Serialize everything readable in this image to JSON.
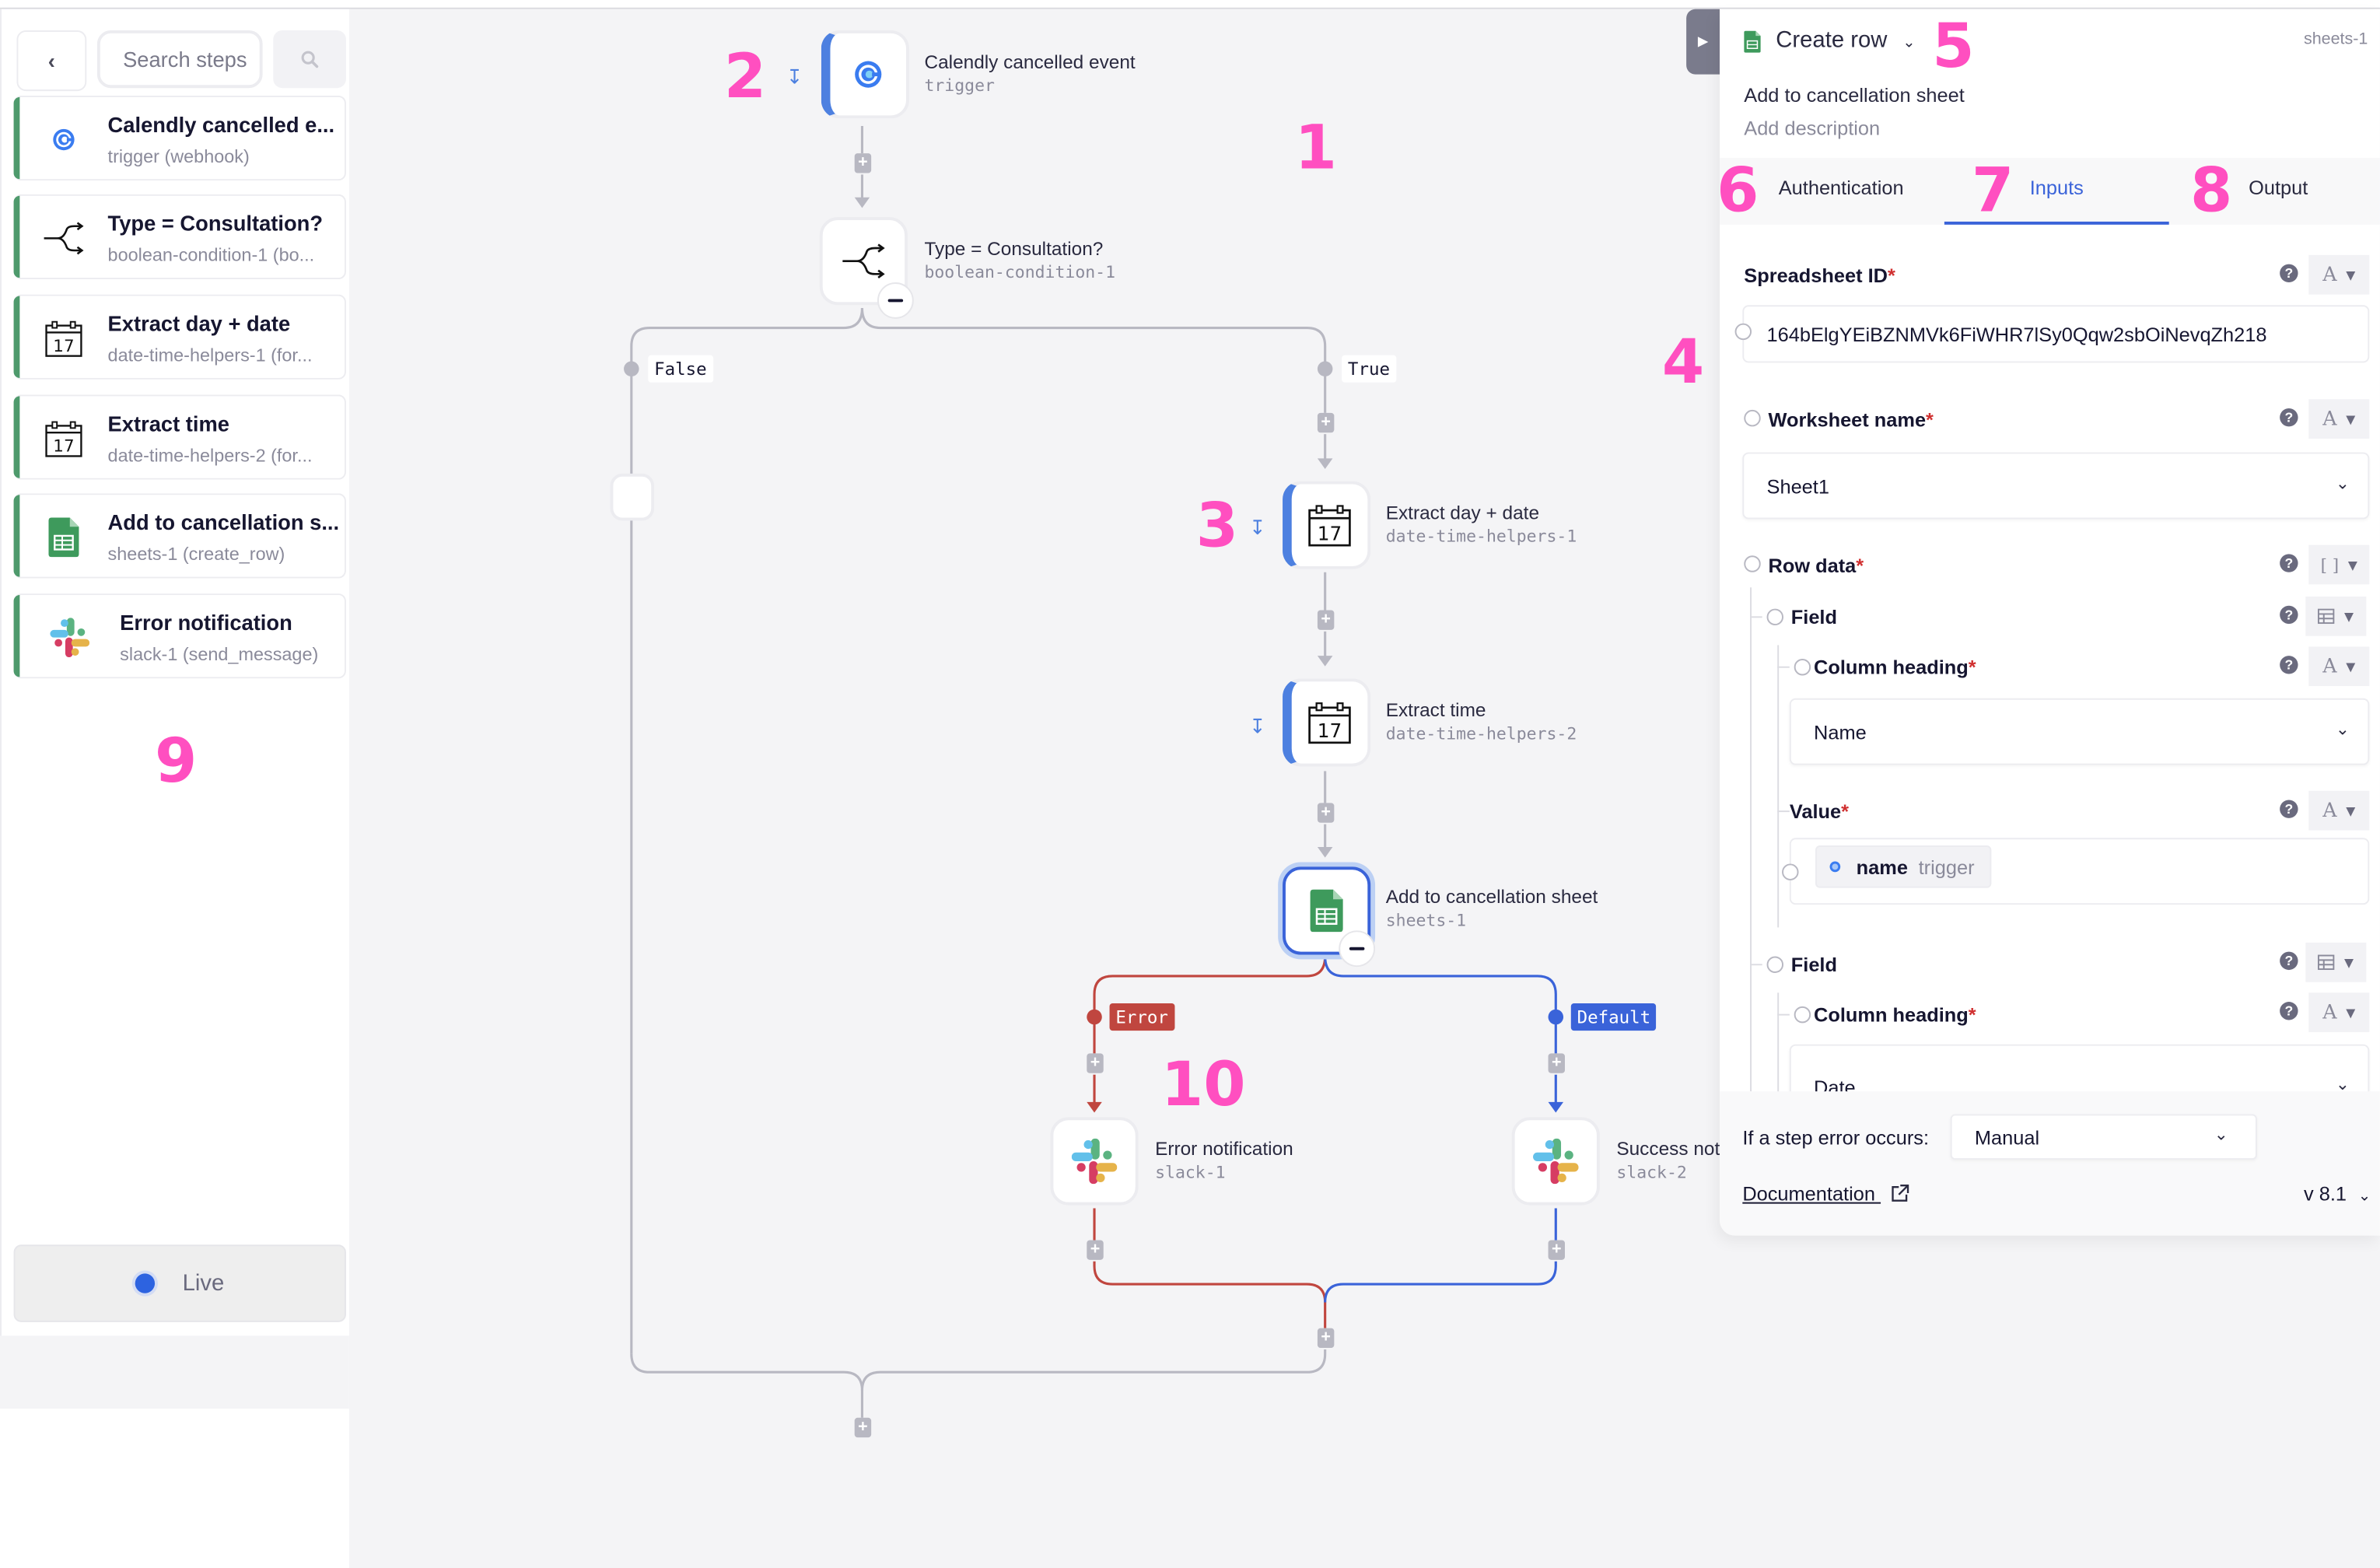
{
  "sidebar": {
    "back_icon": "chevron-left-icon",
    "search_placeholder": "Search steps",
    "search_icon": "search-icon",
    "steps": [
      {
        "title": "Calendly cancelled e...",
        "subtitle": "trigger (webhook)",
        "icon": "calendly-icon"
      },
      {
        "title": "Type = Consultation?",
        "subtitle": "boolean-condition-1 (bo...",
        "icon": "branch-icon"
      },
      {
        "title": "Extract day + date",
        "subtitle": "date-time-helpers-1 (for...",
        "icon": "calendar-icon"
      },
      {
        "title": "Extract time",
        "subtitle": "date-time-helpers-2 (for...",
        "icon": "calendar-icon"
      },
      {
        "title": "Add to cancellation s...",
        "subtitle": "sheets-1 (create_row)",
        "icon": "google-sheets-icon"
      },
      {
        "title": "Error notification",
        "subtitle": "slack-1 (send_message)",
        "icon": "slack-icon"
      }
    ],
    "live_label": "Live",
    "live_color": "#2d63e0"
  },
  "canvas": {
    "nodes": {
      "trigger": {
        "title": "Calendly cancelled event",
        "subtitle": "trigger"
      },
      "condition": {
        "title": "Type = Consultation?",
        "subtitle": "boolean-condition-1"
      },
      "extract_date": {
        "title": "Extract day + date",
        "subtitle": "date-time-helpers-1",
        "calendar_day": "17"
      },
      "extract_time": {
        "title": "Extract time",
        "subtitle": "date-time-helpers-2",
        "calendar_day": "17"
      },
      "sheets": {
        "title": "Add to cancellation sheet",
        "subtitle": "sheets-1"
      },
      "error_notification": {
        "title": "Error notification",
        "subtitle": "slack-1"
      },
      "success_notification": {
        "title": "Success not",
        "subtitle": "slack-2"
      }
    },
    "branches": {
      "false_label": "False",
      "true_label": "True",
      "error_label": "Error",
      "default_label": "Default"
    },
    "colors": {
      "error": "#c0463f",
      "default": "#3a63d9",
      "connector": "#b8b8c2",
      "node_accent": "#4d80e0"
    },
    "plus_symbol": "+"
  },
  "annotations": [
    "1",
    "2",
    "3",
    "4",
    "5",
    "6",
    "7",
    "8",
    "9",
    "10"
  ],
  "panel": {
    "action_title": "Create row",
    "step_id": "sheets-1",
    "step_name": "Add to cancellation sheet",
    "description_placeholder": "Add description",
    "tabs": [
      {
        "label": "Authentication",
        "active": false
      },
      {
        "label": "Inputs",
        "active": true
      },
      {
        "label": "Output",
        "active": false
      }
    ],
    "fields": {
      "spreadsheet_id": {
        "label": "Spreadsheet ID",
        "required": "*",
        "value": "164bElgYEiBZNMVk6FiWHR7lSy0Qqw2sbOiNevqZh218",
        "type_icon": "A"
      },
      "worksheet_name": {
        "label": "Worksheet name",
        "required": "*",
        "value": "Sheet1",
        "type_icon": "A"
      },
      "row_data": {
        "label": "Row data",
        "required": "*",
        "type_icon": "[ ]"
      },
      "field_1": {
        "label": "Field",
        "column_heading": {
          "label": "Column heading",
          "required": "*",
          "value": "Name",
          "type_icon": "A"
        },
        "value": {
          "label": "Value",
          "required": "*",
          "type_icon": "A",
          "chip_name": "name",
          "chip_source": "trigger"
        }
      },
      "field_2": {
        "label": "Field",
        "column_heading": {
          "label": "Column heading",
          "required": "*",
          "value": "Date",
          "type_icon": "A"
        }
      }
    },
    "footer": {
      "error_label": "If a step error occurs:",
      "error_option": "Manual",
      "docs_label": "Documentation",
      "version": "v 8.1"
    }
  }
}
